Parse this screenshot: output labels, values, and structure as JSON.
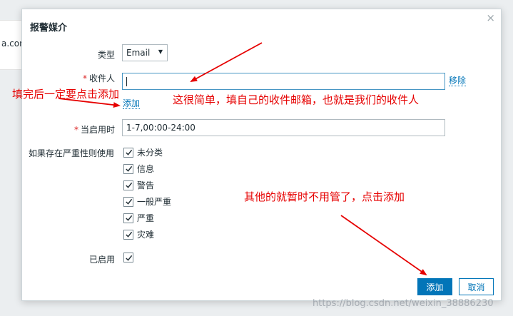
{
  "background": {
    "partial_text": "a.com"
  },
  "dialog": {
    "title": "报警媒介",
    "close_glyph": "×",
    "type": {
      "label": "类型",
      "value": "Email",
      "arrow": "▼"
    },
    "recipient": {
      "required_mark": "*",
      "label": "收件人",
      "value": "",
      "remove_link": "移除",
      "add_link": "添加"
    },
    "active_time": {
      "required_mark": "*",
      "label": "当启用时",
      "value": "1-7,00:00-24:00"
    },
    "severity": {
      "label": "如果存在严重性则使用",
      "items": [
        {
          "label": "未分类",
          "checked": true
        },
        {
          "label": "信息",
          "checked": true
        },
        {
          "label": "警告",
          "checked": true
        },
        {
          "label": "一般严重",
          "checked": true
        },
        {
          "label": "严重",
          "checked": true
        },
        {
          "label": "灾难",
          "checked": true
        }
      ]
    },
    "enabled": {
      "label": "已启用",
      "checked": true
    },
    "buttons": {
      "add": "添加",
      "cancel": "取消"
    }
  },
  "annotations": {
    "note_add": "填完后一定要点击添加",
    "note_email": "这很简单，填自己的收件邮箱，也就是我们的收件人",
    "note_other": "其他的就暂时不用管了，点击添加",
    "arrow_color": "#e60000"
  },
  "watermark": "https://blog.csdn.net/weixin_38886230"
}
